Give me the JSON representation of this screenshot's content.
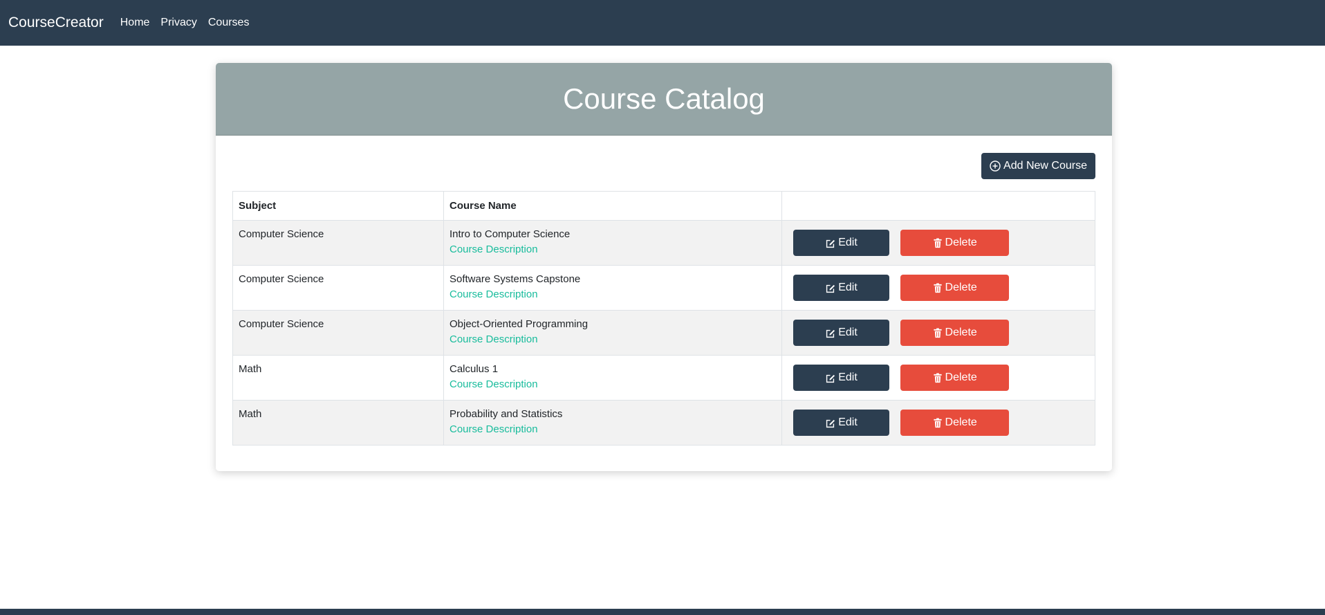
{
  "navbar": {
    "brand": "CourseCreator",
    "links": [
      "Home",
      "Privacy",
      "Courses"
    ]
  },
  "catalog": {
    "title": "Course Catalog",
    "add_button_label": "Add New Course",
    "columns": [
      "Subject",
      "Course Name",
      ""
    ],
    "rows": [
      {
        "subject": "Computer Science",
        "course_name": "Intro to Computer Science",
        "description_link": "Course Description",
        "edit_label": "Edit",
        "delete_label": "Delete"
      },
      {
        "subject": "Computer Science",
        "course_name": "Software Systems Capstone",
        "description_link": "Course Description",
        "edit_label": "Edit",
        "delete_label": "Delete"
      },
      {
        "subject": "Computer Science",
        "course_name": "Object-Oriented Programming",
        "description_link": "Course Description",
        "edit_label": "Edit",
        "delete_label": "Delete"
      },
      {
        "subject": "Math",
        "course_name": "Calculus 1",
        "description_link": "Course Description",
        "edit_label": "Edit",
        "delete_label": "Delete"
      },
      {
        "subject": "Math",
        "course_name": "Probability and Statistics",
        "description_link": "Course Description",
        "edit_label": "Edit",
        "delete_label": "Delete"
      }
    ]
  },
  "icons": {
    "add": "plus-circle-icon",
    "edit": "edit-icon",
    "delete": "trash-icon"
  },
  "colors": {
    "primary": "#2c3e50",
    "header": "#95a5a6",
    "danger": "#e74c3c",
    "link": "#18bc9c"
  }
}
